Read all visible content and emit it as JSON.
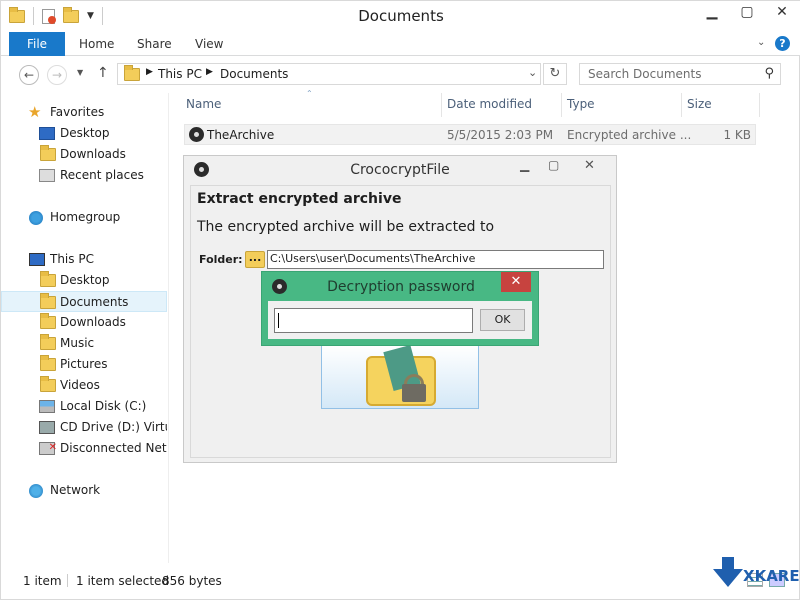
{
  "window": {
    "title": "Documents",
    "icons": {
      "folder": "folder-icon",
      "minimize": "minimize-icon",
      "maximize": "maximize-icon",
      "close": "close-icon"
    }
  },
  "ribbon": {
    "tabs": [
      {
        "label": "File"
      },
      {
        "label": "Home"
      },
      {
        "label": "Share"
      },
      {
        "label": "View"
      }
    ]
  },
  "address": {
    "crumbs": [
      "This PC",
      "Documents"
    ],
    "search_placeholder": "Search Documents"
  },
  "nav": {
    "favorites": {
      "label": "Favorites",
      "items": [
        {
          "label": "Desktop"
        },
        {
          "label": "Downloads"
        },
        {
          "label": "Recent places"
        }
      ]
    },
    "homegroup": {
      "label": "Homegroup"
    },
    "thispc": {
      "label": "This PC",
      "items": [
        {
          "label": "Desktop"
        },
        {
          "label": "Documents"
        },
        {
          "label": "Downloads"
        },
        {
          "label": "Music"
        },
        {
          "label": "Pictures"
        },
        {
          "label": "Videos"
        },
        {
          "label": "Local Disk (C:)"
        },
        {
          "label": "CD Drive (D:) Virtual"
        },
        {
          "label": "Disconnected Network"
        }
      ]
    },
    "network": {
      "label": "Network"
    }
  },
  "files": {
    "columns": [
      "Name",
      "Date modified",
      "Type",
      "Size"
    ],
    "rows": [
      {
        "name": "TheArchive",
        "date": "5/5/2015 2:03 PM",
        "type": "Encrypted archive ...",
        "size": "1 KB"
      }
    ]
  },
  "status": {
    "count": "1 item",
    "selected": "1 item selected",
    "size": "856 bytes"
  },
  "croc": {
    "title": "CrococryptFile",
    "heading": "Extract encrypted archive",
    "text": "The encrypted archive will be extracted to",
    "folder_label": "Folder:",
    "folder_btn": "...",
    "folder_path": "C:\\Users\\user\\Documents\\TheArchive"
  },
  "password": {
    "title": "Decryption password",
    "value": "",
    "ok": "OK",
    "close": "✕"
  },
  "colors": {
    "accent": "#1979ca",
    "dialog_green": "#48b884",
    "close_red": "#c7433f"
  },
  "watermark": "XKARE"
}
